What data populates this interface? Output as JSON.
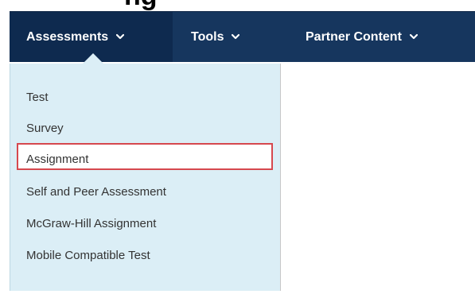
{
  "heading": {
    "text": "ng"
  },
  "nav": {
    "tabs": [
      {
        "label": "Assessments",
        "icon": "chevron-down-icon",
        "active": true
      },
      {
        "label": "Tools",
        "icon": "chevron-down-icon",
        "active": false
      },
      {
        "label": "Partner Content",
        "icon": "chevron-down-icon",
        "active": false
      }
    ]
  },
  "dropdown": {
    "items": [
      {
        "label": "Test"
      },
      {
        "label": "Survey"
      },
      {
        "label": "Assignment",
        "highlighted": true
      },
      {
        "label": "Self and Peer Assessment"
      },
      {
        "label": "McGraw-Hill Assignment"
      },
      {
        "label": "Mobile Compatible Test"
      }
    ]
  },
  "colors": {
    "navbar": "#16365e",
    "navbar_active": "#0e2a4f",
    "dropdown_bg": "#dbeef6",
    "highlight_border": "#d6484e",
    "menu_text": "#333333"
  }
}
